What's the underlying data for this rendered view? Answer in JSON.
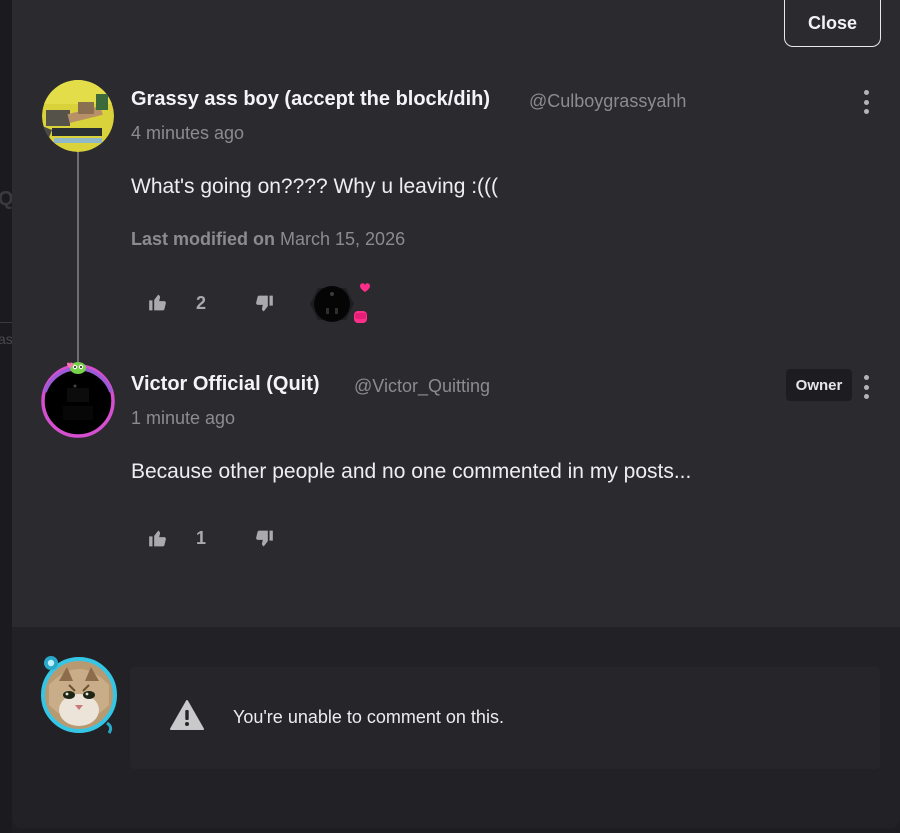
{
  "window": {
    "close_label": "Close"
  },
  "backdrop": {
    "ghost_q": "Q",
    "ghost_as": "as"
  },
  "comments": [
    {
      "name": "Grassy ass boy (accept the block/dih)",
      "handle": "@Culboygrassyahh",
      "time": "4 minutes ago",
      "body": "What's going on???? Why u leaving :(((",
      "modified_label": "Last modified on",
      "modified_date": "March 15, 2026",
      "upvotes": "2",
      "icons": {
        "upvote": "thumbs-up-icon",
        "downvote": "thumbs-down-icon",
        "reaction": "reaction-avatar-icon",
        "menu": "kebab-menu-icon"
      }
    },
    {
      "name": "Victor Official (Quit)",
      "handle": "@Victor_Quitting",
      "time": "1 minute ago",
      "body": "Because other people and no one commented in my posts...",
      "badge": "Owner",
      "upvotes": "1",
      "icons": {
        "upvote": "thumbs-up-icon",
        "downvote": "thumbs-down-icon",
        "menu": "kebab-menu-icon"
      }
    }
  ],
  "composer": {
    "notice": "You're unable to comment on this.",
    "icon": "warning-triangle-icon"
  },
  "colors": {
    "modal_bg": "#2b2a2f",
    "footer_bg": "#222125",
    "reaction_pink": "#ff2e8a",
    "owner_ring": "#d64fd0",
    "current_user_ring": "#35c6e6"
  }
}
